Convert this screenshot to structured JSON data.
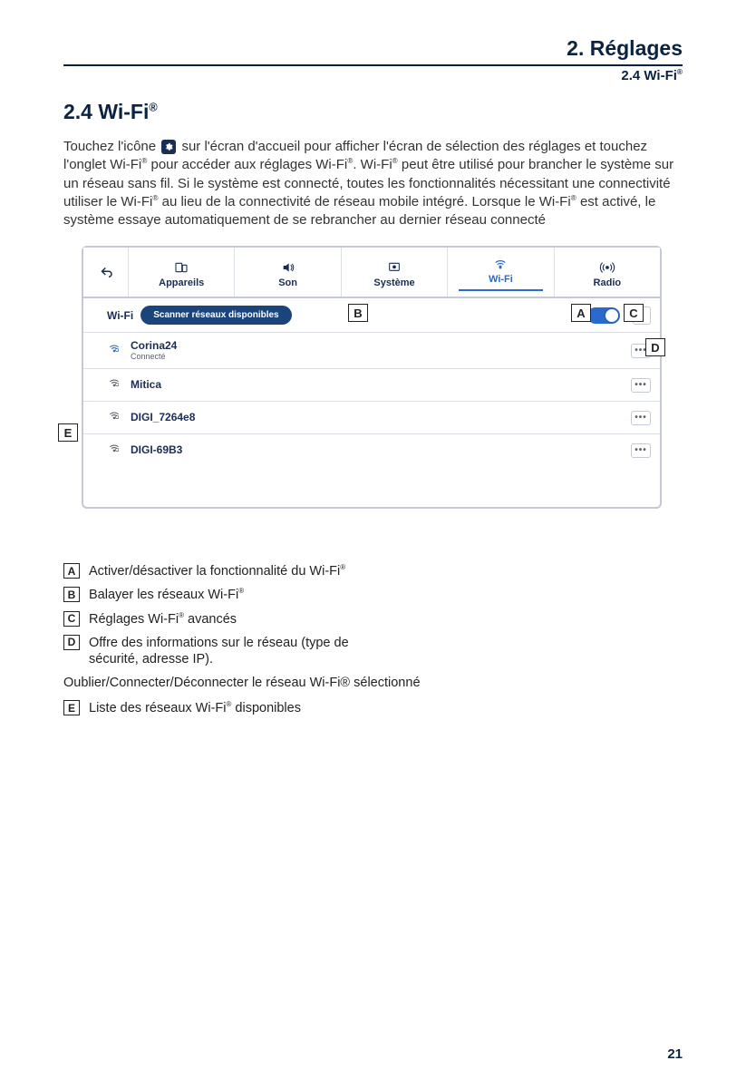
{
  "header": {
    "chapter": "2.  Réglages",
    "sub": "2.4  Wi-Fi"
  },
  "section_title": "2.4  Wi-Fi",
  "intro": {
    "part1": "Touchez l'icône ",
    "part2": " sur l'écran d'accueil pour afficher l'écran de sélection des réglages et touchez l'onglet Wi-Fi",
    "part3": " pour accéder aux réglages Wi-Fi",
    "part4": ". Wi-Fi",
    "part5": " peut être utilisé pour brancher le système sur un réseau sans fil. Si le système est connecté, toutes les fonctionnalités nécessitant une connectivité utiliser le Wi-Fi",
    "part6": " au lieu de la connectivité de réseau mobile intégré. Lorsque le Wi-Fi",
    "part7": " est activé, le système essaye automatiquement de se rebrancher au dernier réseau connecté"
  },
  "tabs": [
    {
      "label": "Appareils"
    },
    {
      "label": "Son"
    },
    {
      "label": "Système"
    },
    {
      "label": "Wi-Fi"
    },
    {
      "label": "Radio"
    }
  ],
  "scan_row": {
    "label": "Wi-Fi",
    "button": "Scanner réseaux disponibles"
  },
  "networks": [
    {
      "name": "Corina24",
      "sub": "Connecté"
    },
    {
      "name": "Mitica",
      "sub": ""
    },
    {
      "name": "DIGI_7264e8",
      "sub": ""
    },
    {
      "name": "DIGI-69B3",
      "sub": ""
    }
  ],
  "callouts": {
    "A": "A",
    "B": "B",
    "C": "C",
    "D": "D",
    "E": "E"
  },
  "legend": [
    {
      "k": "A",
      "t": "Activer/désactiver la fonctionnalité du Wi-Fi",
      "sup": true
    },
    {
      "k": "B",
      "t": "Balayer les réseaux Wi-Fi",
      "sup": true
    },
    {
      "k": "C",
      "t": "Réglages Wi-Fi",
      "sup_mid": " avancés"
    },
    {
      "k": "D",
      "t": "Offre des informations sur le réseau (type de sécurité, adresse IP)."
    },
    {
      "k": "E",
      "t": "Liste des réseaux Wi-Fi",
      "sup_mid": " disponibles"
    }
  ],
  "legend_extra": "Oublier/Connecter/Déconnecter le réseau Wi-Fi® sélectionné",
  "page_number": "21"
}
